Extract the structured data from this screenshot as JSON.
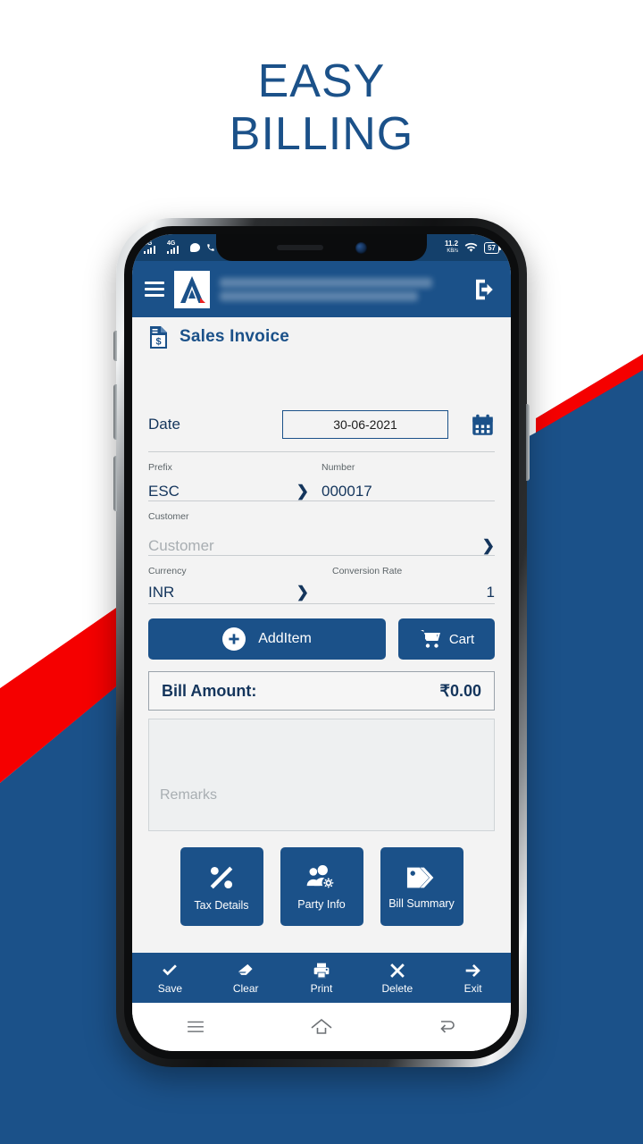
{
  "headline": {
    "line1": "EASY",
    "line2": "BILLING"
  },
  "theme": {
    "brand_blue": "#1b5189",
    "accent_red": "#f50000",
    "page_bg": "#f3f3f3",
    "white": "#ffffff"
  },
  "phone": {
    "status_bar": {
      "network_1": "4G",
      "network_2": "4G",
      "data_rate": "11.2",
      "data_rate_unit": "KB/s",
      "battery": "57"
    },
    "app_bar": {
      "menu_icon": "hamburger-icon",
      "logo_icon": "app-logo-icon",
      "title_blurred_line_1": "",
      "title_blurred_line_2": "",
      "logout_icon": "logout-icon"
    },
    "page": {
      "icon": "invoice-document-icon",
      "title": "Sales Invoice"
    },
    "form": {
      "date_label": "Date",
      "date_value": "30-06-2021",
      "calendar_icon": "calendar-icon",
      "prefix_label": "Prefix",
      "prefix_value": "ESC",
      "number_label": "Number",
      "number_value": "000017",
      "customer_label": "Customer",
      "customer_placeholder": "Customer",
      "currency_label": "Currency",
      "currency_value": "INR",
      "conversion_rate_label": "Conversion Rate",
      "conversion_rate_value": "1",
      "chevron_icon": "chevron-right-icon"
    },
    "buttons": {
      "add_item": "AddItem",
      "add_item_icon": "plus-circle-icon",
      "cart": "Cart",
      "cart_icon": "shopping-cart-icon"
    },
    "bill": {
      "label": "Bill Amount:",
      "amount": "₹0.00"
    },
    "remarks": {
      "placeholder": "Remarks"
    },
    "tiles": [
      {
        "label": "Tax Details",
        "icon": "percent-icon"
      },
      {
        "label": "Party Info",
        "icon": "people-gear-icon"
      },
      {
        "label": "Bill Summary",
        "icon": "tags-icon"
      }
    ],
    "action_bar": [
      {
        "label": "Save",
        "icon": "check-icon"
      },
      {
        "label": "Clear",
        "icon": "eraser-icon"
      },
      {
        "label": "Print",
        "icon": "printer-icon"
      },
      {
        "label": "Delete",
        "icon": "close-x-icon"
      },
      {
        "label": "Exit",
        "icon": "arrow-right-icon"
      }
    ],
    "nav_bar": [
      {
        "icon": "recents-icon"
      },
      {
        "icon": "home-icon"
      },
      {
        "icon": "back-icon"
      }
    ]
  }
}
